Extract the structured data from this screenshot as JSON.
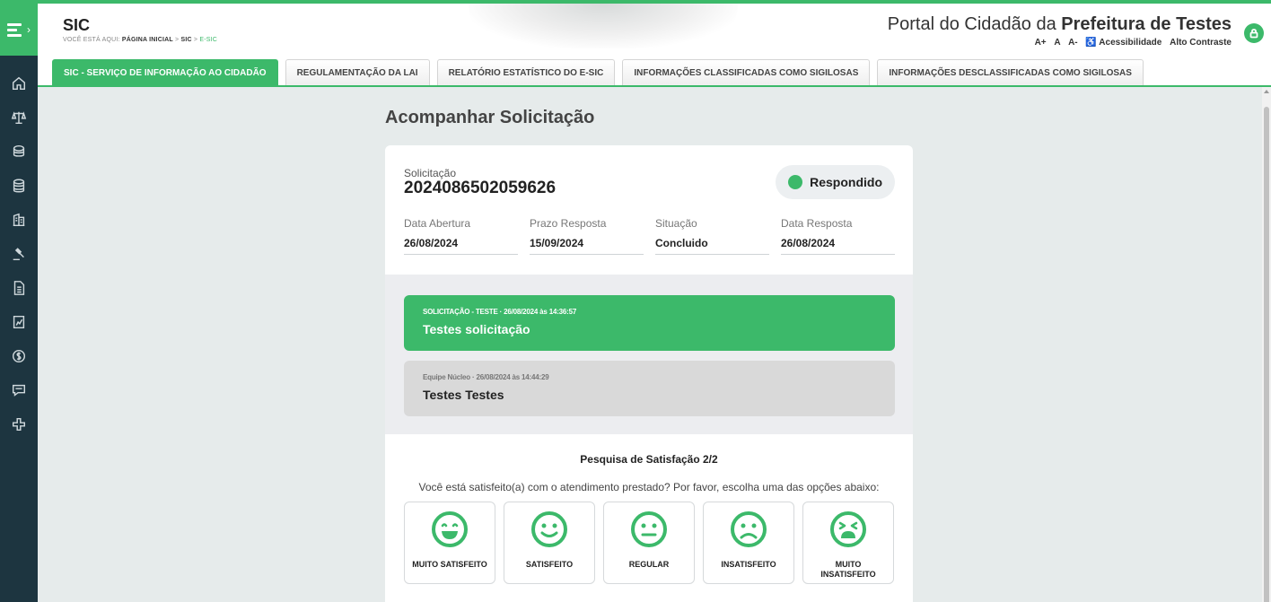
{
  "colors": {
    "accent": "#3cb96a",
    "sidebar": "#1d3540",
    "background": "#e6ebeb"
  },
  "header": {
    "app_title": "SIC",
    "breadcrumb_prefix": "Você está aqui:",
    "breadcrumb_home": "Página Inicial",
    "breadcrumb_sic": "SIC",
    "breadcrumb_current": "E-SIC",
    "sep": ">",
    "portal_prefix": "Portal do Cidadão da",
    "portal_bold": "Prefeitura de Testes",
    "font_plus": "A+",
    "font_normal": "A",
    "font_minus": "A-",
    "accessibility": "Acessibilidade",
    "high_contrast": "Alto Contraste"
  },
  "tabs": [
    {
      "label": "SIC - SERVIÇO DE INFORMAÇÃO AO CIDADÃO",
      "active": true
    },
    {
      "label": "REGULAMENTAÇÃO DA LAI"
    },
    {
      "label": "RELATÓRIO ESTATÍSTICO DO E-SIC"
    },
    {
      "label": "INFORMAÇÕES CLASSIFICADAS COMO SIGILOSAS"
    },
    {
      "label": "INFORMAÇÕES DESCLASSIFICADAS COMO SIGILOSAS"
    }
  ],
  "sidebar_icons": [
    "home-icon",
    "scales-icon",
    "coins-icon",
    "coins-stack-icon",
    "building-icon",
    "gavel-icon",
    "document-icon",
    "chart-document-icon",
    "money-icon",
    "chat-icon",
    "plus-icon"
  ],
  "main": {
    "heading": "Acompanhar Solicitação",
    "request_label": "Solicitação",
    "request_number": "2024086502059626",
    "status": "Respondido",
    "info": [
      {
        "label": "Data Abertura",
        "value": "26/08/2024"
      },
      {
        "label": "Prazo Resposta",
        "value": "15/09/2024"
      },
      {
        "label": "Situação",
        "value": "Concluido"
      },
      {
        "label": "Data Resposta",
        "value": "26/08/2024"
      }
    ],
    "messages": [
      {
        "meta": "SOLICITAÇÃO - TESTE · 26/08/2024 às 14:36:57",
        "text": "Testes solicitação"
      },
      {
        "meta": "Equipe Núcleo · 26/08/2024 às 14:44:29",
        "text": "Testes Testes"
      }
    ],
    "survey": {
      "title": "Pesquisa de Satisfação 2/2",
      "question": "Você está satisfeito(a) com o atendimento prestado? Por favor, escolha uma das opções abaixo:",
      "options": [
        {
          "label": "MUITO SATISFEITO",
          "icon": "very-happy-face-icon"
        },
        {
          "label": "SATISFEITO",
          "icon": "happy-face-icon"
        },
        {
          "label": "REGULAR",
          "icon": "neutral-face-icon"
        },
        {
          "label": "INSATISFEITO",
          "icon": "sad-face-icon"
        },
        {
          "label": "MUITO INSATISFEITO",
          "icon": "very-sad-face-icon"
        }
      ]
    }
  }
}
